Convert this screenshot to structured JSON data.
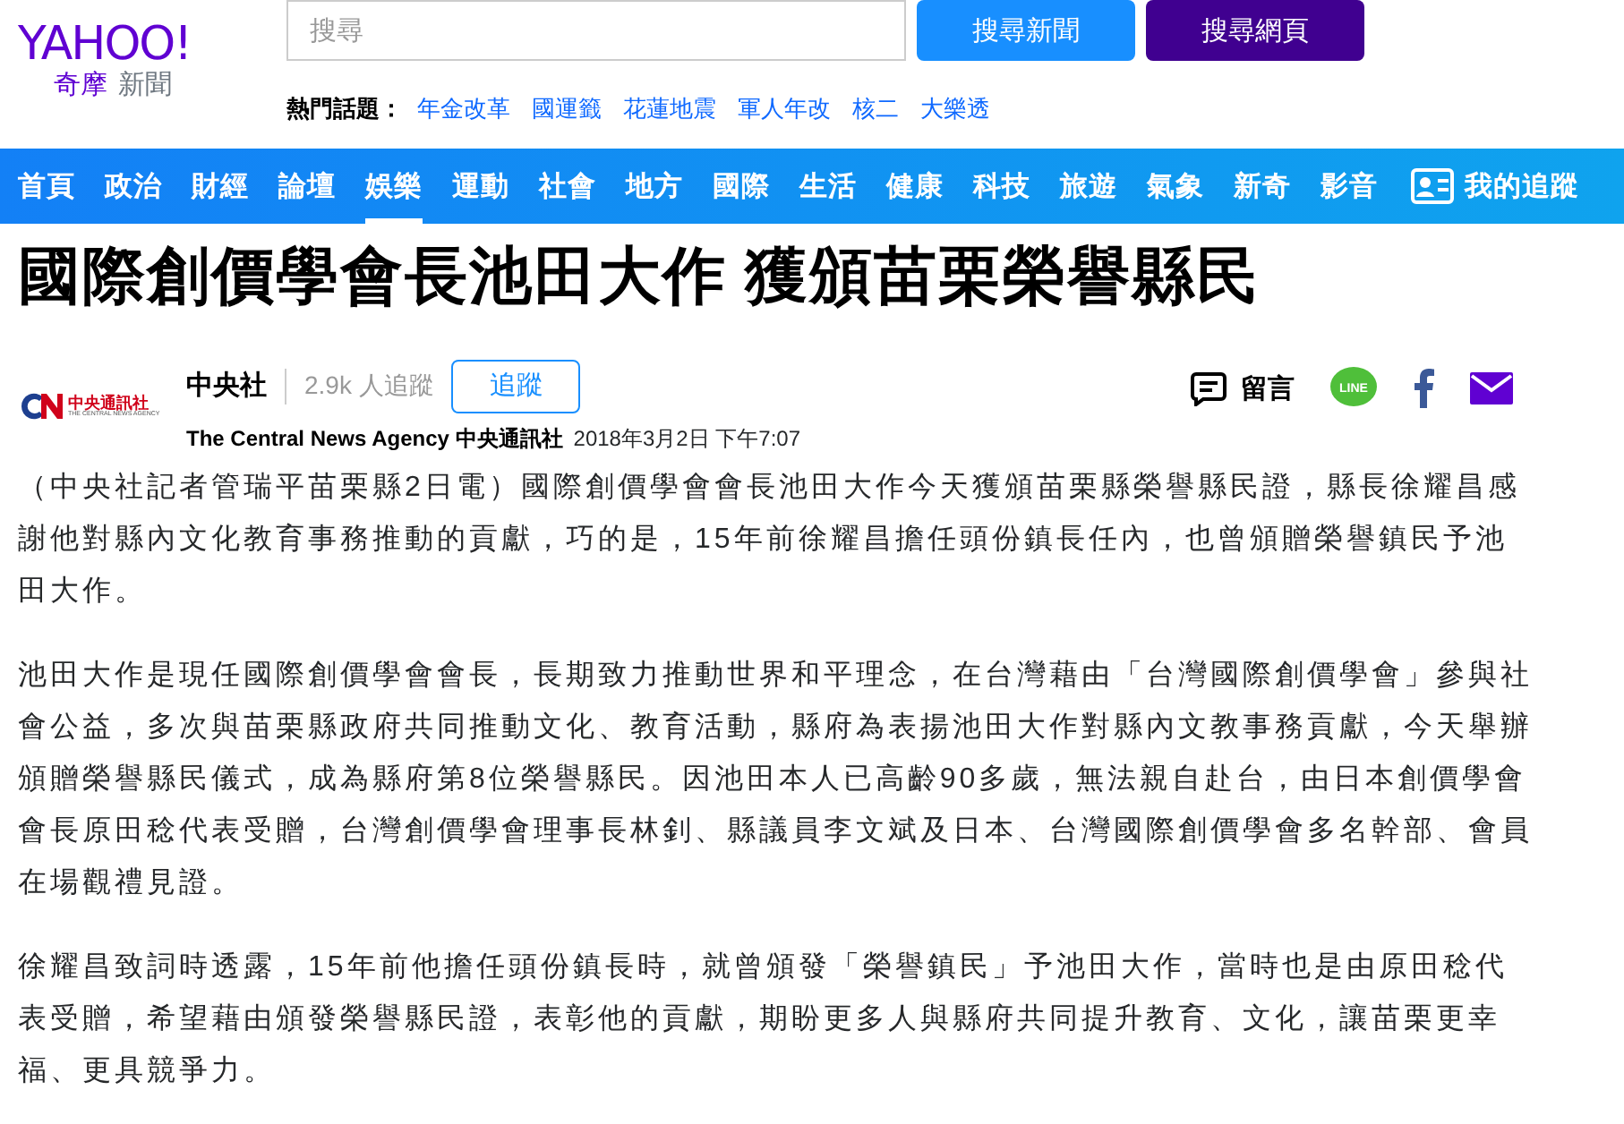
{
  "header": {
    "logo": {
      "brand": "YAHOO!",
      "sub": "奇摩",
      "section": "新聞"
    },
    "search": {
      "placeholder": "搜尋"
    },
    "buttons": [
      {
        "label": "搜尋新聞",
        "kind": "news"
      },
      {
        "label": "搜尋網頁",
        "kind": "web"
      }
    ],
    "hot_topics": {
      "label": "熱門話題：",
      "items": [
        "年金改革",
        "國運籤",
        "花蓮地震",
        "軍人年改",
        "核二",
        "大樂透"
      ]
    }
  },
  "nav": {
    "items": [
      {
        "label": "首頁",
        "selected": false
      },
      {
        "label": "政治",
        "selected": false
      },
      {
        "label": "財經",
        "selected": false
      },
      {
        "label": "論壇",
        "selected": false
      },
      {
        "label": "娛樂",
        "selected": true
      },
      {
        "label": "運動",
        "selected": false
      },
      {
        "label": "社會",
        "selected": false
      },
      {
        "label": "地方",
        "selected": false
      },
      {
        "label": "國際",
        "selected": false
      },
      {
        "label": "生活",
        "selected": false
      },
      {
        "label": "健康",
        "selected": false
      },
      {
        "label": "科技",
        "selected": false
      },
      {
        "label": "旅遊",
        "selected": false
      },
      {
        "label": "氣象",
        "selected": false
      },
      {
        "label": "新奇",
        "selected": false
      },
      {
        "label": "影音",
        "selected": false
      }
    ],
    "follow": "我的追蹤"
  },
  "article": {
    "title": "國際創價學會長池田大作 獲頒苗栗榮譽縣民",
    "source": {
      "logo_text": "中央通訊社",
      "logo_sub": "THE CENTRAL NEWS AGENCY",
      "name": "中央社",
      "followers": "2.9k 人追蹤",
      "follow_button": "追蹤",
      "full_name": "The Central News Agency 中央通訊社",
      "date": "2018年3月2日 下午7:07"
    },
    "share": {
      "comment": "留言",
      "line": "LINE"
    },
    "paragraphs": [
      "（中央社記者管瑞平苗栗縣2日電）國際創價學會會長池田大作今天獲頒苗栗縣榮譽縣民證，縣長徐耀昌感謝他對縣內文化教育事務推動的貢獻，巧的是，15年前徐耀昌擔任頭份鎮長任內，也曾頒贈榮譽鎮民予池田大作。",
      "池田大作是現任國際創價學會會長，長期致力推動世界和平理念，在台灣藉由「台灣國際創價學會」參與社會公益，多次與苗栗縣政府共同推動文化、教育活動，縣府為表揚池田大作對縣內文教事務貢獻，今天舉辦頒贈榮譽縣民儀式，成為縣府第8位榮譽縣民。因池田本人已高齡90多歲，無法親自赴台，由日本創價學會會長原田稔代表受贈，台灣創價學會理事長林釗、縣議員李文斌及日本、台灣國際創價學會多名幹部、會員在場觀禮見證。",
      "徐耀昌致詞時透露，15年前他擔任頭份鎮長時，就曾頒發「榮譽鎮民」予池田大作，當時也是由原田稔代表受贈，希望藉由頒發榮譽縣民證，表彰他的貢獻，期盼更多人與縣府共同提升教育、文化，讓苗栗更幸福、更具競爭力。"
    ]
  }
}
